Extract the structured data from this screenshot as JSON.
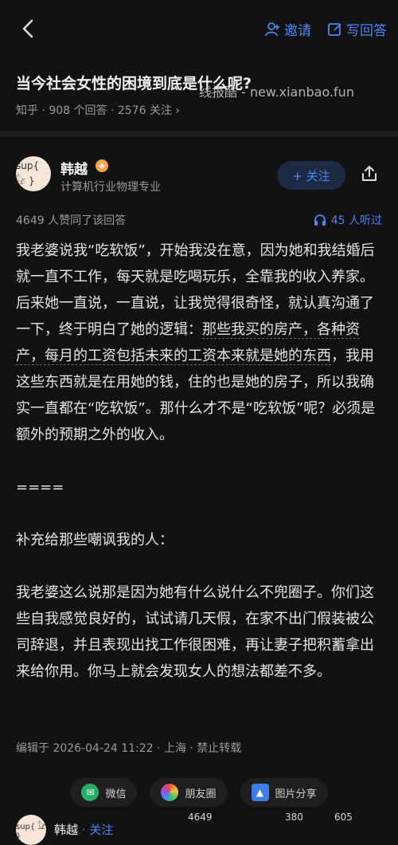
{
  "topbar": {
    "invite_label": "邀请",
    "write_label": "写回答"
  },
  "watermark": "线报酷 - new.xianbao.fun",
  "question": {
    "title": "当今社会女性的困境到底是什么呢?",
    "meta": "知乎 · 908 个回答 · 2576 关注 ›"
  },
  "author": {
    "avatar_text": "sup{ 𓃠 }",
    "name": "韩越",
    "badge": "◈",
    "desc": "计算机行业物理专业",
    "follow_label": "+ 关注"
  },
  "stats": {
    "votes": "4649 人赞同了该回答",
    "listens": "45 人听过"
  },
  "answer": {
    "p1_a": "我老婆说我“吃软饭”，开始我没在意，因为她和我结婚后就一直不工作，每天就是吃喝玩乐，全靠我的收入养家。后来她一直说，一直说，让我觉得很奇怪，就认真沟通了一下，终于明白了她的逻辑：",
    "p1_b": "那些我买的房产，各种资产，每月的工资包括未来的工资本来就是她的东西",
    "p1_c": "，我用这些东西就是在用她的钱，住的也是她的房子，所以我确实一直都在“吃软饭”。那什么才不是“吃软饭”呢？必须是额外的预期之外的收入。",
    "sep": "====",
    "p2": "补充给那些嘲讽我的人：",
    "p3": "我老婆这么说那是因为她有什么说什么不兜圈子。你们这些自我感觉良好的，试试请几天假，在家不出门假装被公司辞退，并且表现出找工作很困难，再让妻子把积蓄拿出来给你用。你马上就会发现女人的想法都差不多。"
  },
  "edit_meta": "编辑于 2026-04-24 11:22 · 上海 · 禁止转载",
  "share": {
    "wechat": "微信",
    "moments": "朋友圈",
    "image": "图片分享"
  },
  "bottom": {
    "name": "韩越",
    "follow": "· 关注",
    "likes": "4649",
    "favs": "380",
    "comments": "605"
  },
  "colors": {
    "accent": "#4a86f5",
    "background": "#121212"
  }
}
